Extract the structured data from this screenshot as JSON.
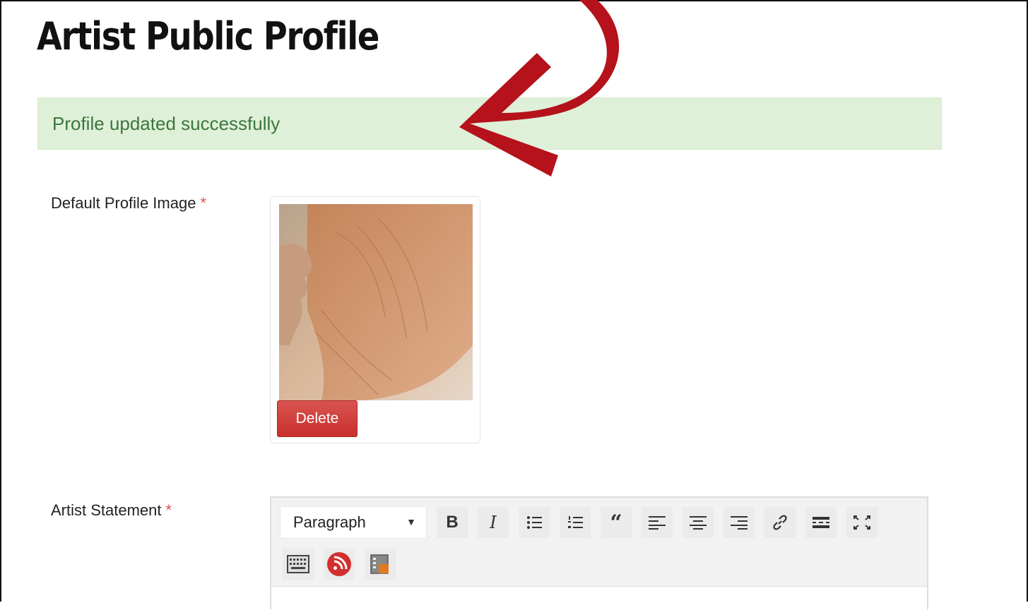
{
  "page": {
    "title": "Artist Public Profile"
  },
  "alert": {
    "message": "Profile updated successfully",
    "color": "#3c763d",
    "background": "#dff0d8"
  },
  "fields": {
    "profile_image": {
      "label": "Default Profile Image",
      "required_mark": "*",
      "delete_label": "Delete"
    },
    "artist_statement": {
      "label": "Artist Statement",
      "required_mark": "*"
    }
  },
  "editor": {
    "format_value": "Paragraph",
    "toolbar_icons": [
      "bold-icon",
      "italic-icon",
      "bullet-list-icon",
      "numbered-list-icon",
      "blockquote-icon",
      "align-left-icon",
      "align-center-icon",
      "align-right-icon",
      "link-icon",
      "horizontal-rule-icon",
      "fullscreen-icon",
      "keyboard-icon",
      "rss-icon",
      "media-icon"
    ],
    "bold_glyph": "B",
    "italic_glyph": "I",
    "quote_glyph": "66"
  },
  "annotation": {
    "arrow_color": "#b5121b"
  }
}
